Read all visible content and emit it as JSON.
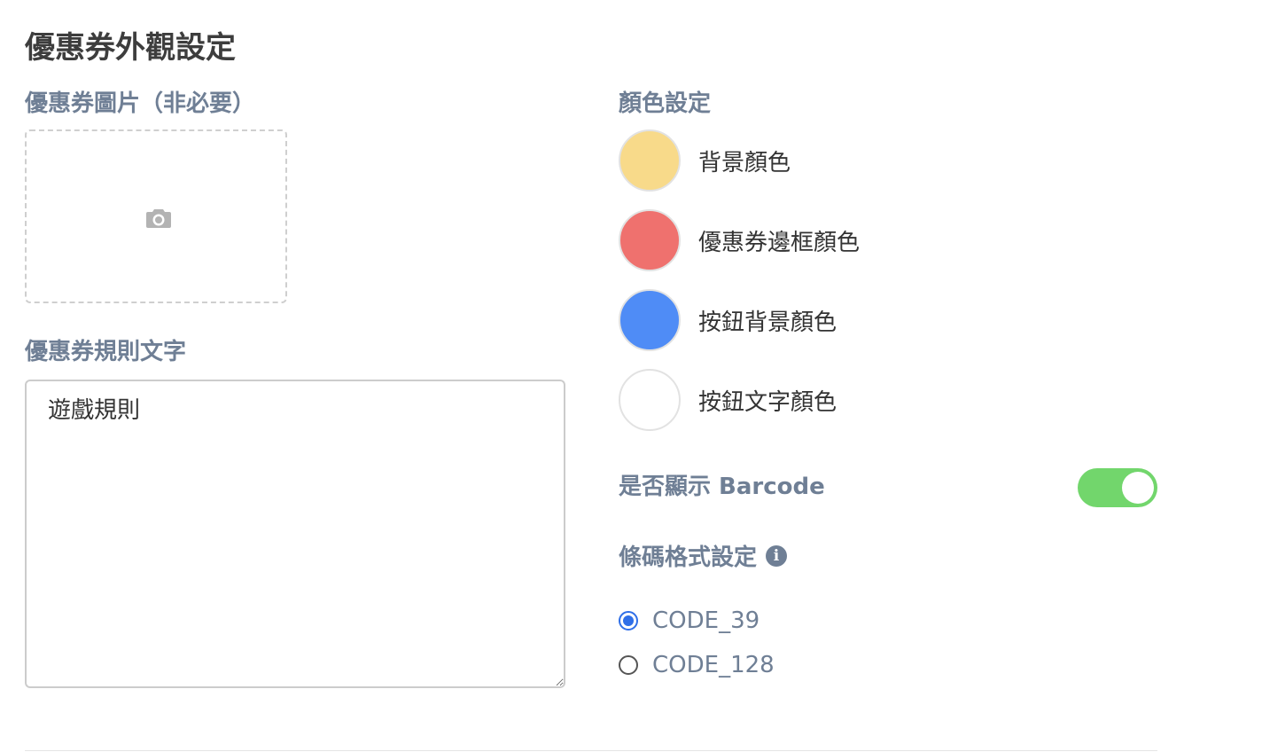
{
  "page": {
    "title": "優惠券外觀設定"
  },
  "image_upload": {
    "label": "優惠券圖片（非必要）",
    "icon": "camera-icon"
  },
  "rules": {
    "label": "優惠券規則文字",
    "value": "遊戲規則"
  },
  "colors": {
    "label": "顏色設定",
    "items": [
      {
        "label": "背景顏色",
        "color": "#f8da8a"
      },
      {
        "label": "優惠券邊框顏色",
        "color": "#ef716e"
      },
      {
        "label": "按鈕背景顏色",
        "color": "#4f8cf6"
      },
      {
        "label": "按鈕文字顏色",
        "color": "#ffffff"
      }
    ]
  },
  "barcode_toggle": {
    "label": "是否顯示 Barcode",
    "enabled": true,
    "color": "#72d66c"
  },
  "barcode_format": {
    "label": "條碼格式設定",
    "info_icon": "info-icon",
    "options": [
      {
        "label": "CODE_39",
        "selected": true
      },
      {
        "label": "CODE_128",
        "selected": false
      }
    ]
  }
}
